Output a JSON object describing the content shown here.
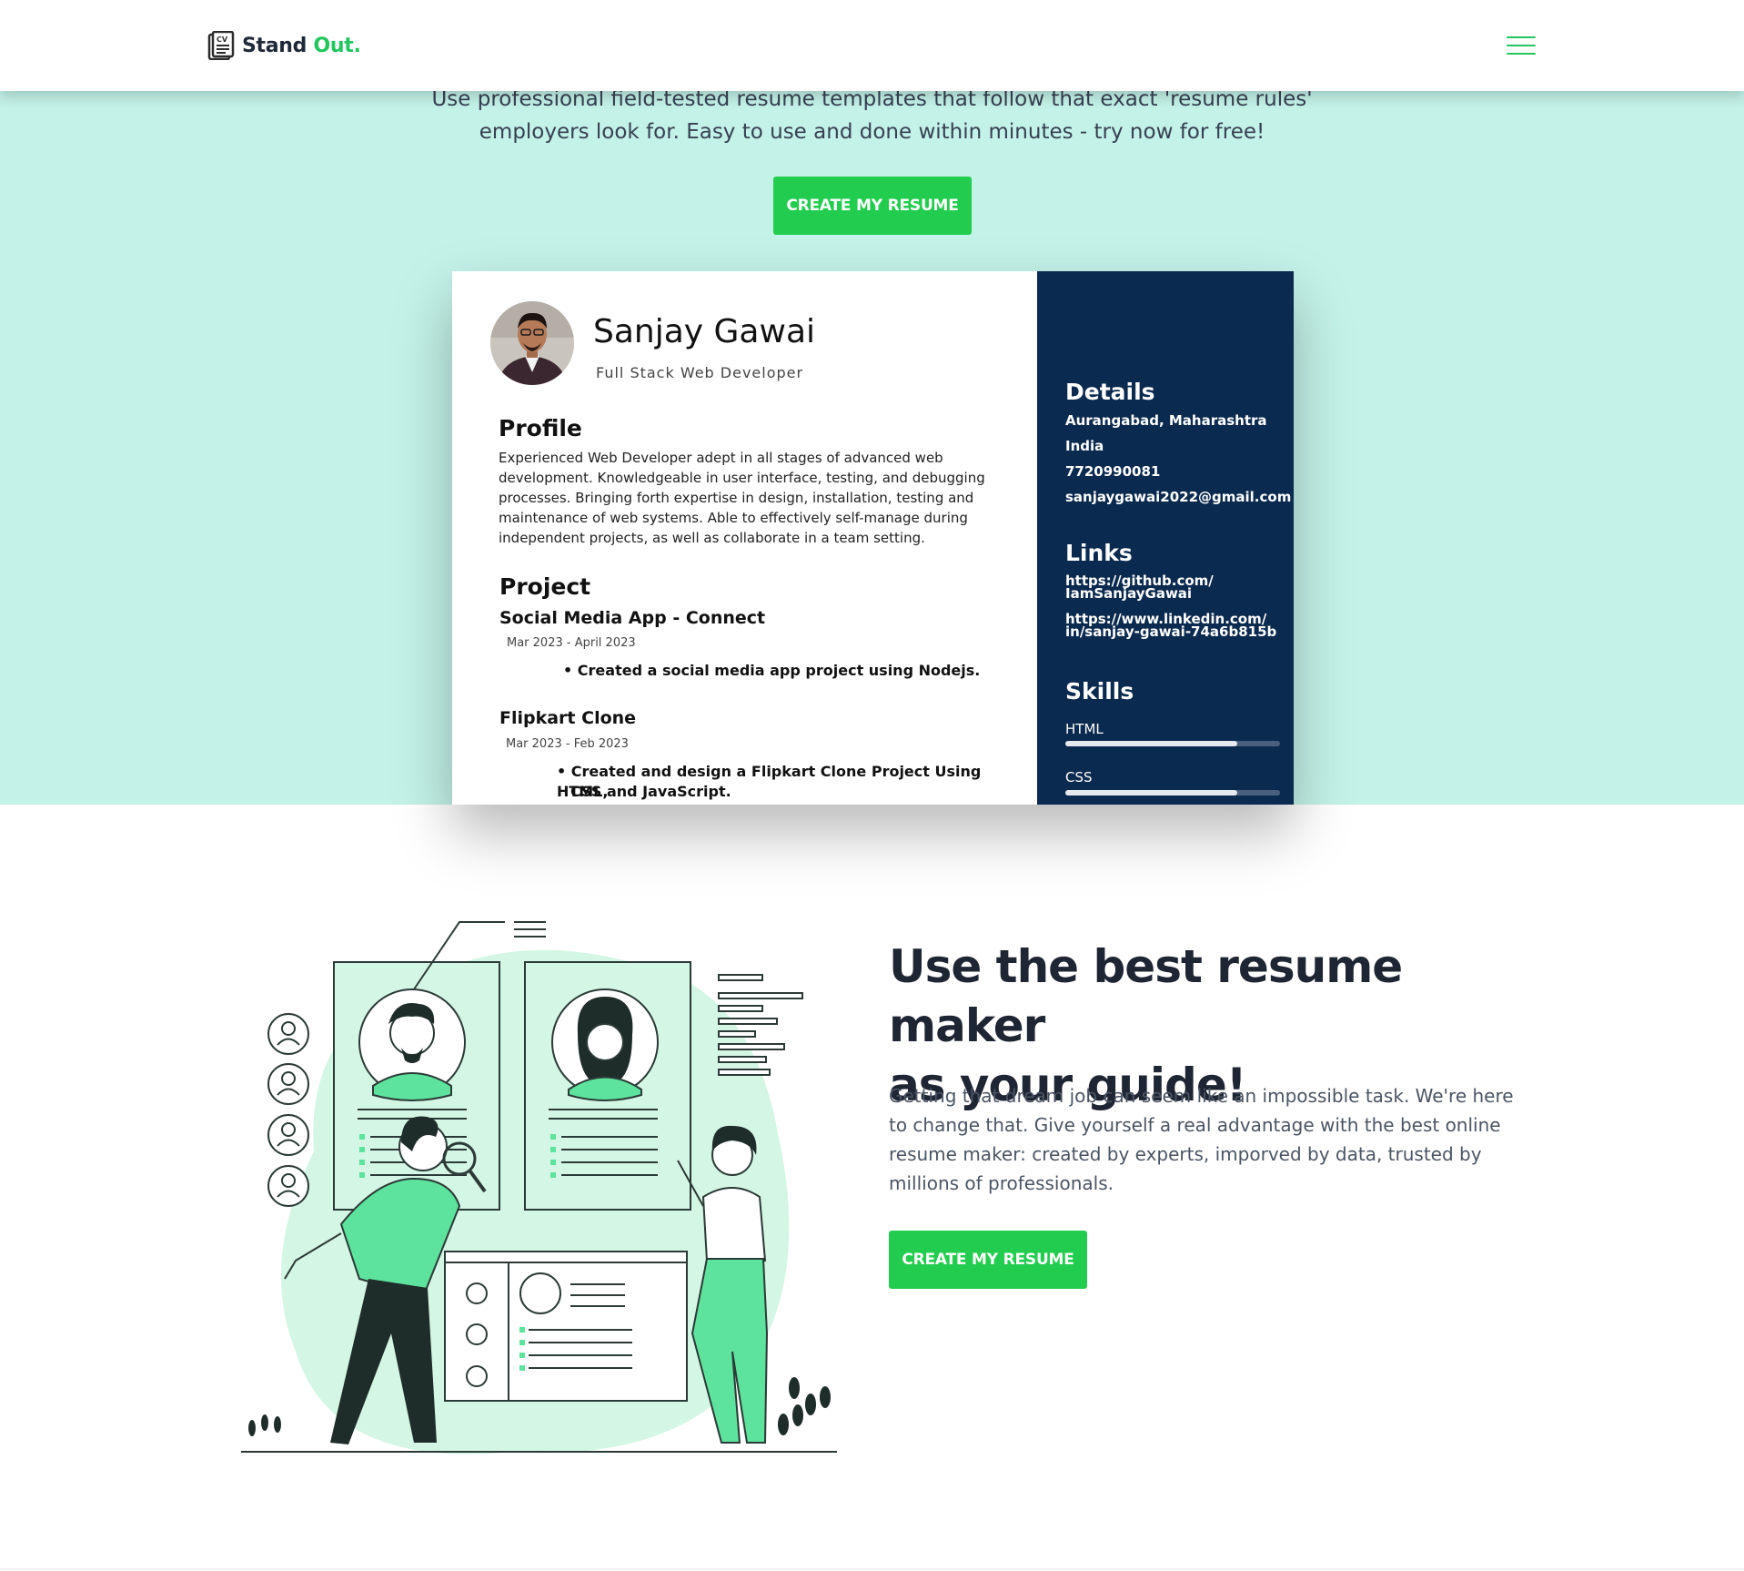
{
  "brand": {
    "name_part1": "Stand",
    "name_part2": "Out.",
    "accent_color": "#22c55e",
    "logo_icon": "cv-document-icon"
  },
  "nav": {
    "menu_icon": "hamburger-menu-icon"
  },
  "hero": {
    "text": "Use professional field-tested resume templates that follow that exact 'resume rules' employers look for. Easy to use and done within minutes - try now for free!",
    "cta_label": "CREATE MY RESUME",
    "background_color": "#c3f2e8"
  },
  "resume": {
    "name": "Sanjay Gawai",
    "title": "Full Stack Web Developer",
    "profile_heading": "Profile",
    "profile_text": "Experienced Web Developer adept in all stages of advanced web development. Knowledgeable in user interface, testing, and debugging processes. Bringing forth expertise in design, installation, testing and maintenance of web systems. Able to effectively self-manage during independent projects, as well as collaborate in a team setting.",
    "project_heading": "Project",
    "projects": [
      {
        "name": "Social Media App -  Connect",
        "dates": "Mar 2023 -  April 2023",
        "bullet": "Created a social media app project using Nodejs."
      },
      {
        "name": "Flipkart Clone",
        "dates": "Mar 2023 -  Feb 2023",
        "bullet_line1": "Created and design a Flipkart Clone Project Using HTML,",
        "bullet_line2": "CSS and JavaScript."
      }
    ],
    "details_heading": "Details",
    "details": [
      "Aurangabad, Maharashtra",
      "India",
      "7720990081",
      "sanjaygawai2022@gmail.com"
    ],
    "links_heading": "Links",
    "links": [
      {
        "line1": "https://github.com/",
        "line2": "IamSanjayGawai"
      },
      {
        "line1": "https://www.linkedin.com/",
        "line2": "in/sanjay-gawai-74a6b815b"
      }
    ],
    "skills_heading": "Skills",
    "skills": [
      {
        "name": "HTML",
        "level": 0.8
      },
      {
        "name": "CSS",
        "level": 0.8
      }
    ],
    "sidebar_color": "#0b2a4f"
  },
  "guide": {
    "title_line1": "Use the best resume maker",
    "title_line2": "as your guide!",
    "text": "Getting that dream job can seem like an impossible task. We're here to change that. Give yourself a real advantage with the best online resume maker: created by experts, imporved by data, trusted by millions of professionals.",
    "cta_label": "CREATE MY RESUME"
  }
}
